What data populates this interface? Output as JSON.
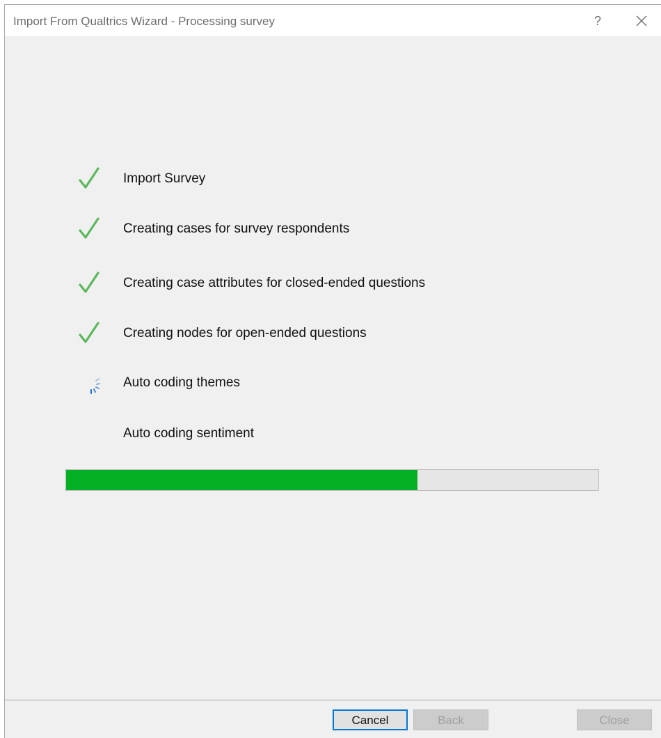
{
  "window": {
    "title": "Import From Qualtrics Wizard - Processing survey",
    "help_label": "?",
    "close_icon": "close-icon"
  },
  "steps": [
    {
      "label": "Import Survey",
      "status": "done",
      "icon": "checkmark-icon"
    },
    {
      "label": "Creating cases for survey respondents",
      "status": "done",
      "icon": "checkmark-icon"
    },
    {
      "label": "Creating case attributes for closed-ended questions",
      "status": "done",
      "icon": "checkmark-icon"
    },
    {
      "label": "Creating nodes for open-ended questions",
      "status": "done",
      "icon": "checkmark-icon"
    },
    {
      "label": "Auto coding themes",
      "status": "in-progress",
      "icon": "spinner-icon"
    },
    {
      "label": "Auto coding sentiment",
      "status": "pending",
      "icon": ""
    }
  ],
  "progress": {
    "fraction": 0.66,
    "fill_color": "#06b025",
    "track_color": "#e6e6e6"
  },
  "colors": {
    "check": "#5cb85c",
    "spinner": "#1e6fc9"
  },
  "buttons": {
    "cancel": "Cancel",
    "back": "Back",
    "close": "Close"
  }
}
